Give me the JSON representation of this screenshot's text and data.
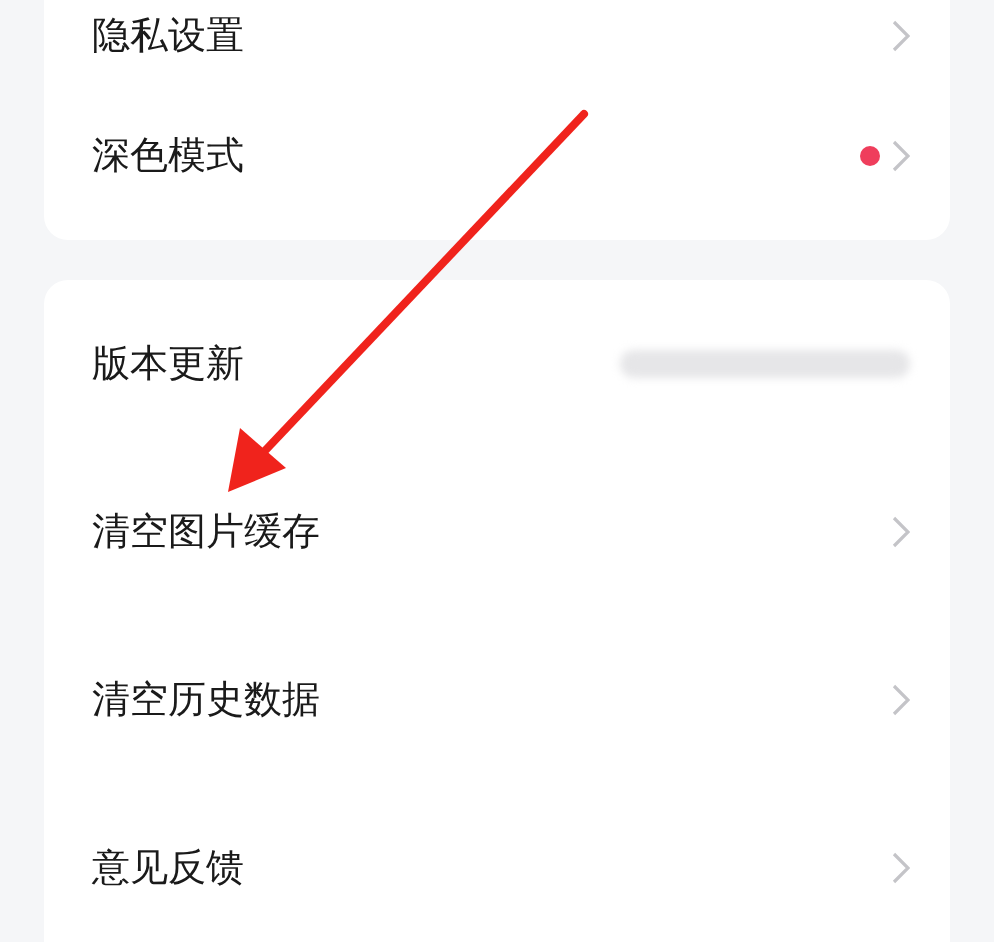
{
  "sections": [
    {
      "items": [
        {
          "label": "隐私设置",
          "kind": "link",
          "dot": false
        },
        {
          "label": "深色模式",
          "kind": "link",
          "dot": true
        }
      ]
    },
    {
      "items": [
        {
          "label": "版本更新",
          "kind": "blurred",
          "dot": false
        },
        {
          "label": "清空图片缓存",
          "kind": "link",
          "dot": false
        },
        {
          "label": "清空历史数据",
          "kind": "link",
          "dot": false
        },
        {
          "label": "意见反馈",
          "kind": "link",
          "dot": false
        }
      ]
    }
  ],
  "annotation": {
    "kind": "arrow"
  }
}
